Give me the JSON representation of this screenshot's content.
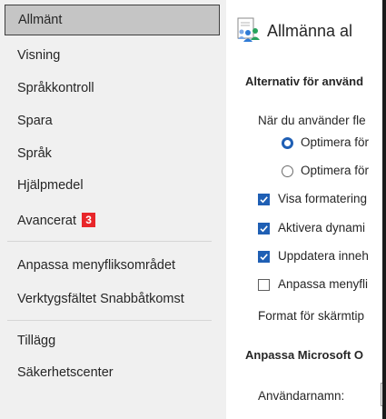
{
  "sidebar": {
    "items": [
      {
        "label": "Allmänt"
      },
      {
        "label": "Visning"
      },
      {
        "label": "Språkkontroll"
      },
      {
        "label": "Spara"
      },
      {
        "label": "Språk"
      },
      {
        "label": "Hjälpmedel"
      },
      {
        "label": "Avancerat",
        "badge": "3"
      },
      {
        "label": "Anpassa menyfliksområdet"
      },
      {
        "label": "Verktygsfältet Snabbåtkomst"
      },
      {
        "label": "Tillägg"
      },
      {
        "label": "Säkerhetscenter"
      }
    ]
  },
  "main": {
    "header": {
      "title": "Allmänna al",
      "icon": "general-options-icon"
    },
    "section1": {
      "title": "Alternativ för använd"
    },
    "multi_display_label": "När du använder fle",
    "radio1": {
      "label": "Optimera för",
      "checked": true
    },
    "radio2": {
      "label": "Optimera för",
      "checked": false
    },
    "cb1": {
      "label": "Visa formatering",
      "checked": true
    },
    "cb2": {
      "label": "Aktivera dynami",
      "checked": true
    },
    "cb3": {
      "label": "Uppdatera inneh",
      "checked": true
    },
    "cb4": {
      "label": "Anpassa menyfli",
      "checked": false
    },
    "tooltip_label": "Format för skärmtip",
    "section2": {
      "title": "Anpassa Microsoft O"
    },
    "username_label": "Användarnamn:"
  },
  "colors": {
    "accent": "#1f5fb4",
    "badge": "#e8262a",
    "sidebar_bg": "#f0f0f0",
    "selected_bg": "#c5c5c5"
  }
}
